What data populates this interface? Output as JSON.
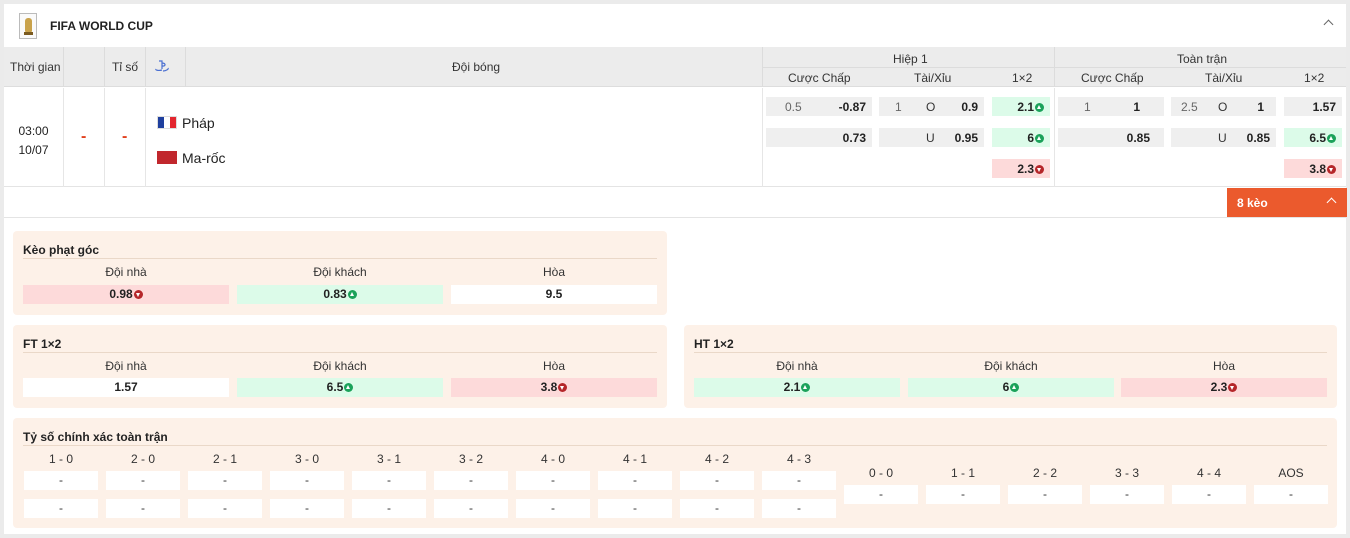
{
  "league": {
    "title": "FIFA WORLD CUP",
    "icon": "trophy-icon"
  },
  "header": {
    "time": "Thời gian",
    "blank": "",
    "score": "Tỉ số",
    "teams": "Đội bóng",
    "half1": "Hiệp 1",
    "full": "Toàn trận",
    "handicap": "Cược Chấp",
    "ou": "Tài/Xỉu",
    "x12": "1×2"
  },
  "match": {
    "time": "03:00",
    "date": "10/07",
    "score_home": "-",
    "score_away": "-",
    "home": "Pháp",
    "away": "Ma-rốc",
    "h1": {
      "hdp_line": "0.5",
      "hdp_home": "-0.87",
      "hdp_away": "0.73",
      "ou_line": "1",
      "ou_o": "O",
      "ou_over": "0.9",
      "ou_u": "U",
      "ou_under": "0.95",
      "x12_1": "2.1",
      "x12_2": "6",
      "x12_x": "2.3"
    },
    "ft": {
      "hdp_line": "1",
      "hdp_home": "1",
      "hdp_away": "0.85",
      "ou_line": "2.5",
      "ou_o": "O",
      "ou_over": "1",
      "ou_u": "U",
      "ou_under": "0.85",
      "x12_1": "1.57",
      "x12_2": "6.5",
      "x12_x": "3.8"
    }
  },
  "more_button": "8 kèo",
  "corner": {
    "title": "Kèo phạt góc",
    "home_label": "Đội nhà",
    "away_label": "Đội khách",
    "draw_label": "Hòa",
    "home": "0.98",
    "away": "0.83",
    "draw": "9.5"
  },
  "ft12": {
    "title": "FT 1×2",
    "home_label": "Đội nhà",
    "away_label": "Đội khách",
    "draw_label": "Hòa",
    "home": "1.57",
    "away": "6.5",
    "draw": "3.8"
  },
  "ht12": {
    "title": "HT 1×2",
    "home_label": "Đội nhà",
    "away_label": "Đội khách",
    "draw_label": "Hòa",
    "home": "2.1",
    "away": "6",
    "draw": "2.3"
  },
  "exact": {
    "title": "Tỷ số chính xác toàn trận",
    "scores": [
      "1 - 0",
      "2 - 0",
      "2 - 1",
      "3 - 0",
      "3 - 1",
      "3 - 2",
      "4 - 0",
      "4 - 1",
      "4 - 2",
      "4 - 3"
    ],
    "draws": [
      "0 - 0",
      "1 - 1",
      "2 - 2",
      "3 - 3",
      "4 - 4",
      "AOS"
    ],
    "empty": "-"
  },
  "colors": {
    "accent": "#eb5a2d",
    "up": "#1ba25a",
    "down": "#b5262a",
    "panel": "#fdf1e8"
  }
}
